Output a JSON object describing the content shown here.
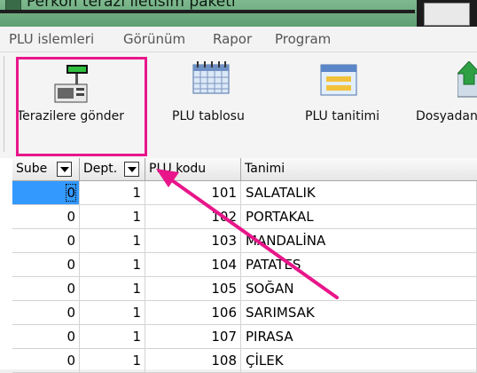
{
  "window": {
    "title": "Perkon terazi iletisim paketi"
  },
  "menu": [
    "PLU islemleri",
    "Görünüm",
    "Rapor",
    "Program"
  ],
  "toolbar": {
    "buttons": [
      {
        "label": "Terazilere gönder",
        "icon": "scale-send-icon"
      },
      {
        "label": "PLU tablosu",
        "icon": "calendar-table-icon"
      },
      {
        "label": "PLU tanitimi",
        "icon": "form-window-icon"
      },
      {
        "label": "Dosyadan",
        "icon": "import-file-icon"
      }
    ]
  },
  "grid": {
    "columns": [
      "Sube",
      "Dept.",
      "PLU kodu",
      "Tanimi"
    ],
    "rows": [
      {
        "sube": "0",
        "dept": "1",
        "plu": "101",
        "tanimi": "SALATALIK"
      },
      {
        "sube": "0",
        "dept": "1",
        "plu": "102",
        "tanimi": "PORTAKAL"
      },
      {
        "sube": "0",
        "dept": "1",
        "plu": "103",
        "tanimi": "MANDALİNA"
      },
      {
        "sube": "0",
        "dept": "1",
        "plu": "104",
        "tanimi": "PATATES"
      },
      {
        "sube": "0",
        "dept": "1",
        "plu": "105",
        "tanimi": "SOĞAN"
      },
      {
        "sube": "0",
        "dept": "1",
        "plu": "106",
        "tanimi": "SARIMSAK"
      },
      {
        "sube": "0",
        "dept": "1",
        "plu": "107",
        "tanimi": "PIRASA"
      },
      {
        "sube": "0",
        "dept": "1",
        "plu": "108",
        "tanimi": "ÇİLEK"
      }
    ]
  },
  "annotation": {
    "color": "#e8168a"
  }
}
